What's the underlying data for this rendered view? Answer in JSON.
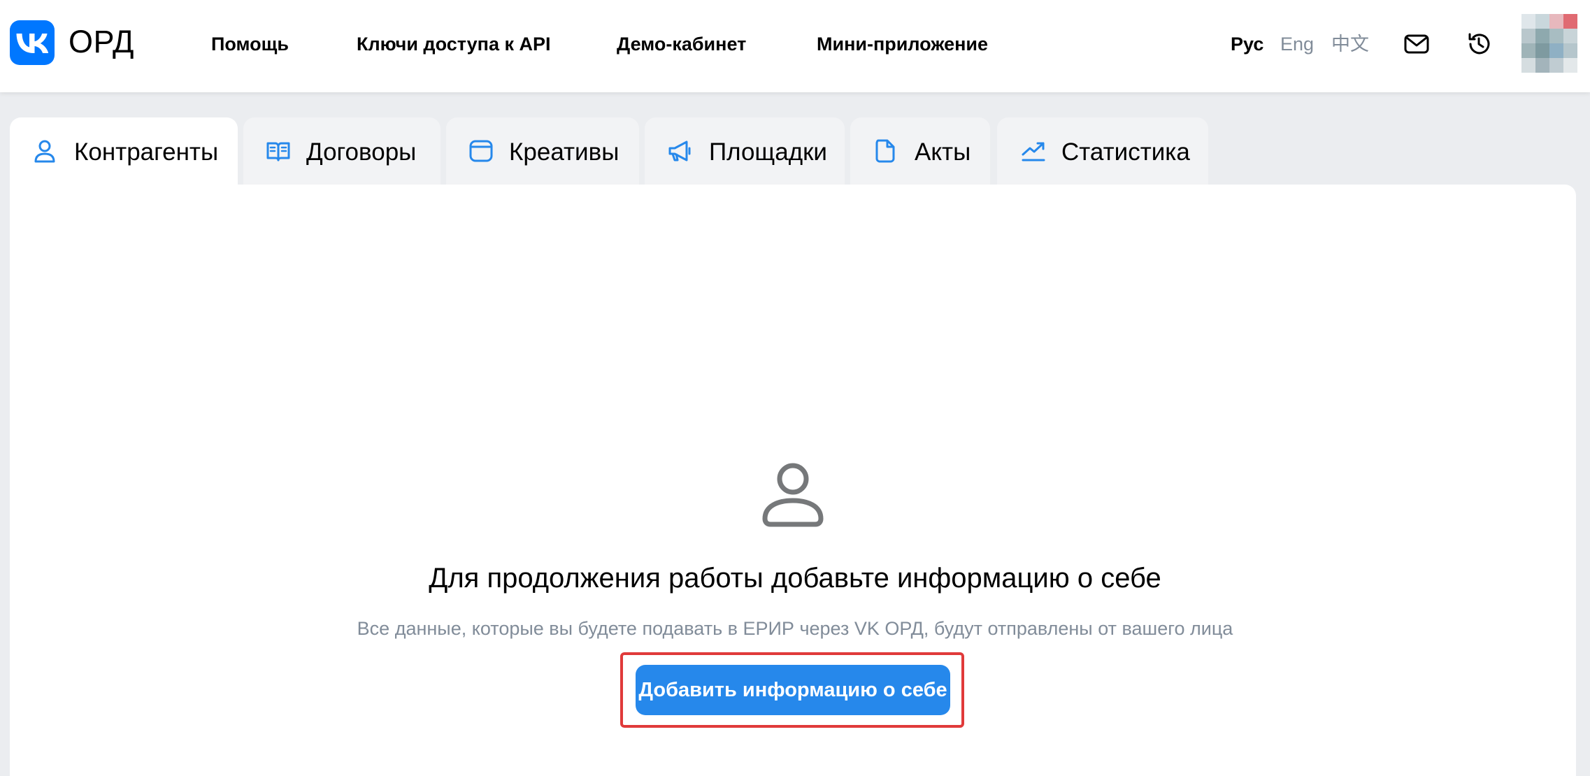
{
  "brand": {
    "logo_icon": "vk-logo-icon",
    "title": "ОРД",
    "color": "#0077ff"
  },
  "nav": {
    "help": "Помощь",
    "api_keys": "Ключи доступа к API",
    "demo": "Демо-кабинет",
    "mini_app": "Мини-приложение"
  },
  "languages": {
    "ru": "Рус",
    "en": "Eng",
    "zh": "中文",
    "active": "ru"
  },
  "header_icons": {
    "mail": "mail-icon",
    "history": "history-icon",
    "avatar": "user-avatar"
  },
  "tabs": [
    {
      "label": "Контрагенты",
      "icon": "user-icon",
      "active": true
    },
    {
      "label": "Договоры",
      "icon": "book-icon",
      "active": false
    },
    {
      "label": "Креативы",
      "icon": "window-icon",
      "active": false
    },
    {
      "label": "Площадки",
      "icon": "megaphone-icon",
      "active": false
    },
    {
      "label": "Акты",
      "icon": "document-icon",
      "active": false
    },
    {
      "label": "Статистика",
      "icon": "trend-chart-icon",
      "active": false
    }
  ],
  "empty_state": {
    "icon": "user-outline-icon",
    "title": "Для продолжения работы добавьте информацию о себе",
    "subtitle": "Все данные, которые вы будете подавать в ЕРИР через VK ОРД, будут отправлены от вашего лица",
    "button_label": "Добавить информацию о себе"
  },
  "colors": {
    "accent": "#2688eb",
    "tab_icon": "#2688eb",
    "muted_text": "#818c99",
    "highlight_frame": "#e03a3a"
  }
}
